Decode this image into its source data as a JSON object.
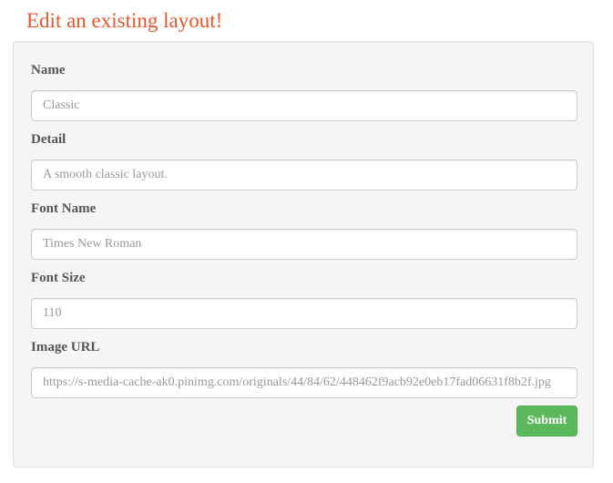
{
  "page": {
    "title": "Edit an existing layout!"
  },
  "form": {
    "fields": [
      {
        "label": "Name",
        "value": "",
        "placeholder": "Classic"
      },
      {
        "label": "Detail",
        "value": "",
        "placeholder": "A smooth classic layout."
      },
      {
        "label": "Font Name",
        "value": "",
        "placeholder": "Times New Roman"
      },
      {
        "label": "Font Size",
        "value": "",
        "placeholder": "110"
      },
      {
        "label": "Image URL",
        "value": "",
        "placeholder": "https://s-media-cache-ak0.pinimg.com/originals/44/84/62/448462f9acb92e0eb17fad06631f8b2f.jpg"
      }
    ],
    "submit_label": "Submit"
  },
  "colors": {
    "title": "#e2572b",
    "submit_background": "#5cb85c",
    "panel_background": "#f5f5f5"
  }
}
